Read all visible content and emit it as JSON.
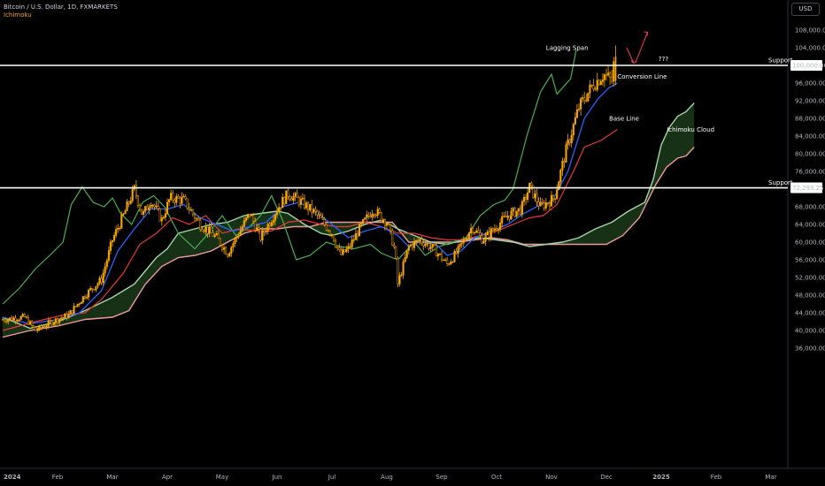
{
  "header": {
    "title": "Bitcoin / U.S. Dollar, 1D, FXMARKETS",
    "indicator": "Ichimoku"
  },
  "currency": "USD",
  "colors": {
    "background": "#000000",
    "candle": "#f7a600",
    "conversion": "#2962ff",
    "base": "#e53935",
    "lagging": "#4caf50",
    "span_a": "#a5d6a7",
    "span_b": "#ef9a9a",
    "cloud": "#1b3a1b",
    "support": "#ffffff",
    "arrow": "#ff3b5c"
  },
  "chart_data": {
    "type": "candlestick",
    "y_ticks": [
      "36,000.00",
      "40,000.00",
      "44,000.00",
      "48,000.00",
      "52,000.00",
      "56,000.00",
      "60,000.00",
      "64,000.00",
      "68,000.00",
      "76,000.00",
      "80,000.00",
      "84,000.00",
      "88,000.00",
      "92,000.00",
      "96,000.00",
      "104,000.00",
      "108,000.00"
    ],
    "ylim": [
      34000,
      110000
    ],
    "x_ticks": [
      {
        "label": "2024",
        "month": 0,
        "bold": true
      },
      {
        "label": "Feb",
        "month": 1
      },
      {
        "label": "Mar",
        "month": 2
      },
      {
        "label": "Apr",
        "month": 3
      },
      {
        "label": "May",
        "month": 4
      },
      {
        "label": "Jun",
        "month": 5
      },
      {
        "label": "Jul",
        "month": 6
      },
      {
        "label": "Aug",
        "month": 7
      },
      {
        "label": "Sep",
        "month": 8
      },
      {
        "label": "Oct",
        "month": 9
      },
      {
        "label": "Nov",
        "month": 10
      },
      {
        "label": "Dec",
        "month": 11
      },
      {
        "label": "2025",
        "month": 12,
        "bold": true
      },
      {
        "label": "Feb",
        "month": 13
      },
      {
        "label": "Mar",
        "month": 14
      }
    ],
    "price_path": [
      [
        0,
        42500
      ],
      [
        0.4,
        43000
      ],
      [
        0.6,
        40000
      ],
      [
        0.9,
        42000
      ],
      [
        1.2,
        43500
      ],
      [
        1.5,
        48000
      ],
      [
        1.8,
        51500
      ],
      [
        2.0,
        60500
      ],
      [
        2.2,
        66000
      ],
      [
        2.4,
        72000
      ],
      [
        2.55,
        66000
      ],
      [
        2.7,
        69500
      ],
      [
        2.9,
        65000
      ],
      [
        3.05,
        70000
      ],
      [
        3.3,
        69500
      ],
      [
        3.6,
        64000
      ],
      [
        3.9,
        61000
      ],
      [
        4.1,
        57500
      ],
      [
        4.3,
        62000
      ],
      [
        4.5,
        66500
      ],
      [
        4.7,
        61000
      ],
      [
        5.0,
        67500
      ],
      [
        5.2,
        71000
      ],
      [
        5.45,
        69000
      ],
      [
        5.7,
        66500
      ],
      [
        6.0,
        62000
      ],
      [
        6.15,
        57000
      ],
      [
        6.3,
        58500
      ],
      [
        6.5,
        63000
      ],
      [
        6.75,
        67500
      ],
      [
        7.0,
        64500
      ],
      [
        7.15,
        58000
      ],
      [
        7.2,
        50500
      ],
      [
        7.4,
        59000
      ],
      [
        7.6,
        60500
      ],
      [
        7.85,
        58500
      ],
      [
        8.1,
        55000
      ],
      [
        8.3,
        58000
      ],
      [
        8.55,
        63500
      ],
      [
        8.75,
        60500
      ],
      [
        8.95,
        63000
      ],
      [
        9.2,
        66000
      ],
      [
        9.45,
        67500
      ],
      [
        9.6,
        72500
      ],
      [
        9.8,
        68000
      ],
      [
        10.05,
        70000
      ],
      [
        10.25,
        80000
      ],
      [
        10.5,
        90500
      ],
      [
        10.75,
        95500
      ],
      [
        10.95,
        98000
      ],
      [
        11.1,
        96500
      ],
      [
        11.15,
        102000
      ]
    ],
    "conversion_path": [
      [
        0,
        43000
      ],
      [
        0.5,
        41500
      ],
      [
        1.0,
        42500
      ],
      [
        1.4,
        44000
      ],
      [
        1.8,
        49000
      ],
      [
        2.1,
        58000
      ],
      [
        2.4,
        63000
      ],
      [
        2.7,
        67500
      ],
      [
        3.0,
        67500
      ],
      [
        3.3,
        68500
      ],
      [
        3.6,
        65500
      ],
      [
        3.9,
        64000
      ],
      [
        4.2,
        62500
      ],
      [
        4.5,
        63500
      ],
      [
        4.8,
        64500
      ],
      [
        5.1,
        68000
      ],
      [
        5.4,
        69000
      ],
      [
        5.7,
        67000
      ],
      [
        6.0,
        64000
      ],
      [
        6.3,
        61000
      ],
      [
        6.6,
        62500
      ],
      [
        6.9,
        63500
      ],
      [
        7.2,
        61500
      ],
      [
        7.4,
        59000
      ],
      [
        7.6,
        60000
      ],
      [
        7.9,
        59500
      ],
      [
        8.1,
        57000
      ],
      [
        8.35,
        58000
      ],
      [
        8.6,
        61000
      ],
      [
        8.9,
        62500
      ],
      [
        9.2,
        64000
      ],
      [
        9.5,
        66500
      ],
      [
        9.8,
        68500
      ],
      [
        10.0,
        69000
      ],
      [
        10.3,
        76000
      ],
      [
        10.6,
        88000
      ],
      [
        10.85,
        92500
      ],
      [
        11.05,
        95000
      ],
      [
        11.2,
        96000
      ]
    ],
    "base_path": [
      [
        0,
        40000
      ],
      [
        0.6,
        42000
      ],
      [
        1.1,
        43500
      ],
      [
        1.5,
        44000
      ],
      [
        1.8,
        47000
      ],
      [
        2.2,
        53000
      ],
      [
        2.5,
        59500
      ],
      [
        2.8,
        62000
      ],
      [
        3.1,
        65500
      ],
      [
        3.4,
        64000
      ],
      [
        3.7,
        66000
      ],
      [
        4.0,
        62000
      ],
      [
        4.3,
        63000
      ],
      [
        4.6,
        62500
      ],
      [
        4.9,
        62500
      ],
      [
        5.2,
        64500
      ],
      [
        5.5,
        65000
      ],
      [
        5.8,
        64000
      ],
      [
        6.1,
        63500
      ],
      [
        6.3,
        63500
      ],
      [
        6.6,
        64500
      ],
      [
        6.9,
        63500
      ],
      [
        7.2,
        62000
      ],
      [
        7.5,
        62000
      ],
      [
        7.8,
        61000
      ],
      [
        8.1,
        60500
      ],
      [
        8.4,
        60500
      ],
      [
        8.7,
        61500
      ],
      [
        9.0,
        62500
      ],
      [
        9.3,
        64000
      ],
      [
        9.6,
        65500
      ],
      [
        9.85,
        66000
      ],
      [
        10.1,
        68500
      ],
      [
        10.4,
        76000
      ],
      [
        10.6,
        81500
      ],
      [
        10.9,
        83000
      ],
      [
        11.2,
        85500
      ]
    ],
    "lagging_path": [
      [
        0,
        46000
      ],
      [
        0.3,
        49500
      ],
      [
        0.6,
        54000
      ],
      [
        0.9,
        57500
      ],
      [
        1.1,
        60000
      ],
      [
        1.25,
        68500
      ],
      [
        1.45,
        72500
      ],
      [
        1.65,
        69000
      ],
      [
        1.85,
        68000
      ],
      [
        2.0,
        70000
      ],
      [
        2.15,
        66500
      ],
      [
        2.35,
        64000
      ],
      [
        2.55,
        69000
      ],
      [
        2.75,
        70500
      ],
      [
        2.95,
        68000
      ],
      [
        3.2,
        62000
      ],
      [
        3.5,
        58500
      ],
      [
        3.75,
        62000
      ],
      [
        4.0,
        66000
      ],
      [
        4.25,
        61500
      ],
      [
        4.5,
        63500
      ],
      [
        4.7,
        66000
      ],
      [
        4.9,
        70500
      ],
      [
        5.1,
        65000
      ],
      [
        5.35,
        56000
      ],
      [
        5.6,
        57000
      ],
      [
        5.9,
        60000
      ],
      [
        6.15,
        59000
      ],
      [
        6.4,
        58500
      ],
      [
        6.7,
        59500
      ],
      [
        6.9,
        57500
      ],
      [
        7.2,
        56000
      ],
      [
        7.5,
        60000
      ],
      [
        7.7,
        57000
      ],
      [
        7.95,
        59000
      ],
      [
        8.2,
        60000
      ],
      [
        8.45,
        61000
      ],
      [
        8.7,
        66000
      ],
      [
        8.95,
        68500
      ],
      [
        9.15,
        69500
      ],
      [
        9.3,
        72000
      ],
      [
        9.55,
        84000
      ],
      [
        9.8,
        94000
      ],
      [
        10.0,
        98000
      ],
      [
        10.1,
        93500
      ],
      [
        10.35,
        97000
      ],
      [
        10.45,
        103500
      ]
    ],
    "span_a_path": [
      [
        0,
        43000
      ],
      [
        0.5,
        40500
      ],
      [
        1.0,
        42000
      ],
      [
        1.5,
        44500
      ],
      [
        2.0,
        47500
      ],
      [
        2.4,
        50500
      ],
      [
        2.6,
        53500
      ],
      [
        2.8,
        56500
      ],
      [
        3.0,
        58500
      ],
      [
        3.2,
        62000
      ],
      [
        3.5,
        63000
      ],
      [
        3.8,
        64000
      ],
      [
        4.1,
        64500
      ],
      [
        4.4,
        66000
      ],
      [
        4.7,
        66500
      ],
      [
        5.0,
        67000
      ],
      [
        5.2,
        66500
      ],
      [
        5.5,
        64000
      ],
      [
        5.8,
        62000
      ],
      [
        6.0,
        61500
      ],
      [
        6.3,
        62500
      ],
      [
        6.6,
        64000
      ],
      [
        6.9,
        65000
      ],
      [
        7.2,
        63000
      ],
      [
        7.5,
        61500
      ],
      [
        7.8,
        60000
      ],
      [
        8.1,
        59500
      ],
      [
        8.4,
        60500
      ],
      [
        8.7,
        61000
      ],
      [
        9.0,
        60500
      ],
      [
        9.3,
        60000
      ],
      [
        9.6,
        59000
      ],
      [
        9.9,
        59500
      ],
      [
        10.2,
        60000
      ],
      [
        10.5,
        61000
      ],
      [
        10.8,
        63000
      ],
      [
        11.1,
        64500
      ],
      [
        11.4,
        67000
      ],
      [
        11.7,
        69000
      ],
      [
        11.85,
        74000
      ],
      [
        12.0,
        82000
      ],
      [
        12.15,
        86000
      ],
      [
        12.3,
        88500
      ],
      [
        12.45,
        89500
      ],
      [
        12.6,
        91500
      ]
    ],
    "span_b_path": [
      [
        0,
        38500
      ],
      [
        0.5,
        40000
      ],
      [
        1.0,
        41000
      ],
      [
        1.5,
        42500
      ],
      [
        2.0,
        43000
      ],
      [
        2.3,
        44500
      ],
      [
        2.6,
        50500
      ],
      [
        2.9,
        54500
      ],
      [
        3.2,
        56500
      ],
      [
        3.5,
        57000
      ],
      [
        3.8,
        58000
      ],
      [
        4.1,
        60000
      ],
      [
        4.4,
        62000
      ],
      [
        4.7,
        63000
      ],
      [
        5.0,
        63000
      ],
      [
        5.3,
        63500
      ],
      [
        5.6,
        63500
      ],
      [
        5.9,
        64500
      ],
      [
        6.2,
        64500
      ],
      [
        6.5,
        64500
      ],
      [
        6.8,
        64500
      ],
      [
        7.1,
        64500
      ],
      [
        7.4,
        60000
      ],
      [
        7.7,
        60000
      ],
      [
        8.0,
        60000
      ],
      [
        8.3,
        60000
      ],
      [
        8.6,
        60500
      ],
      [
        8.9,
        61000
      ],
      [
        9.2,
        60500
      ],
      [
        9.5,
        59500
      ],
      [
        9.8,
        59500
      ],
      [
        10.1,
        59500
      ],
      [
        10.4,
        59500
      ],
      [
        10.7,
        59500
      ],
      [
        11.0,
        59500
      ],
      [
        11.3,
        61500
      ],
      [
        11.6,
        65500
      ],
      [
        11.9,
        73000
      ],
      [
        12.1,
        77000
      ],
      [
        12.3,
        79000
      ],
      [
        12.45,
        79500
      ],
      [
        12.6,
        81500
      ]
    ],
    "support_levels": [
      {
        "price": 100000,
        "value_label": "100,000.00",
        "text": "Support"
      },
      {
        "price": 72293.25,
        "value_label": "72,293.25",
        "text": "Support"
      }
    ],
    "annotations": [
      {
        "text": "Lagging Span",
        "month": 9.9,
        "price": 103500
      },
      {
        "text": "Conversion Line",
        "month": 11.2,
        "price": 97000
      },
      {
        "text": "Base Line",
        "month": 11.05,
        "price": 87500
      },
      {
        "text": "Ichimoku Cloud",
        "month": 12.1,
        "price": 85000
      },
      {
        "text": "???",
        "month": 11.95,
        "price": 101000
      }
    ]
  }
}
